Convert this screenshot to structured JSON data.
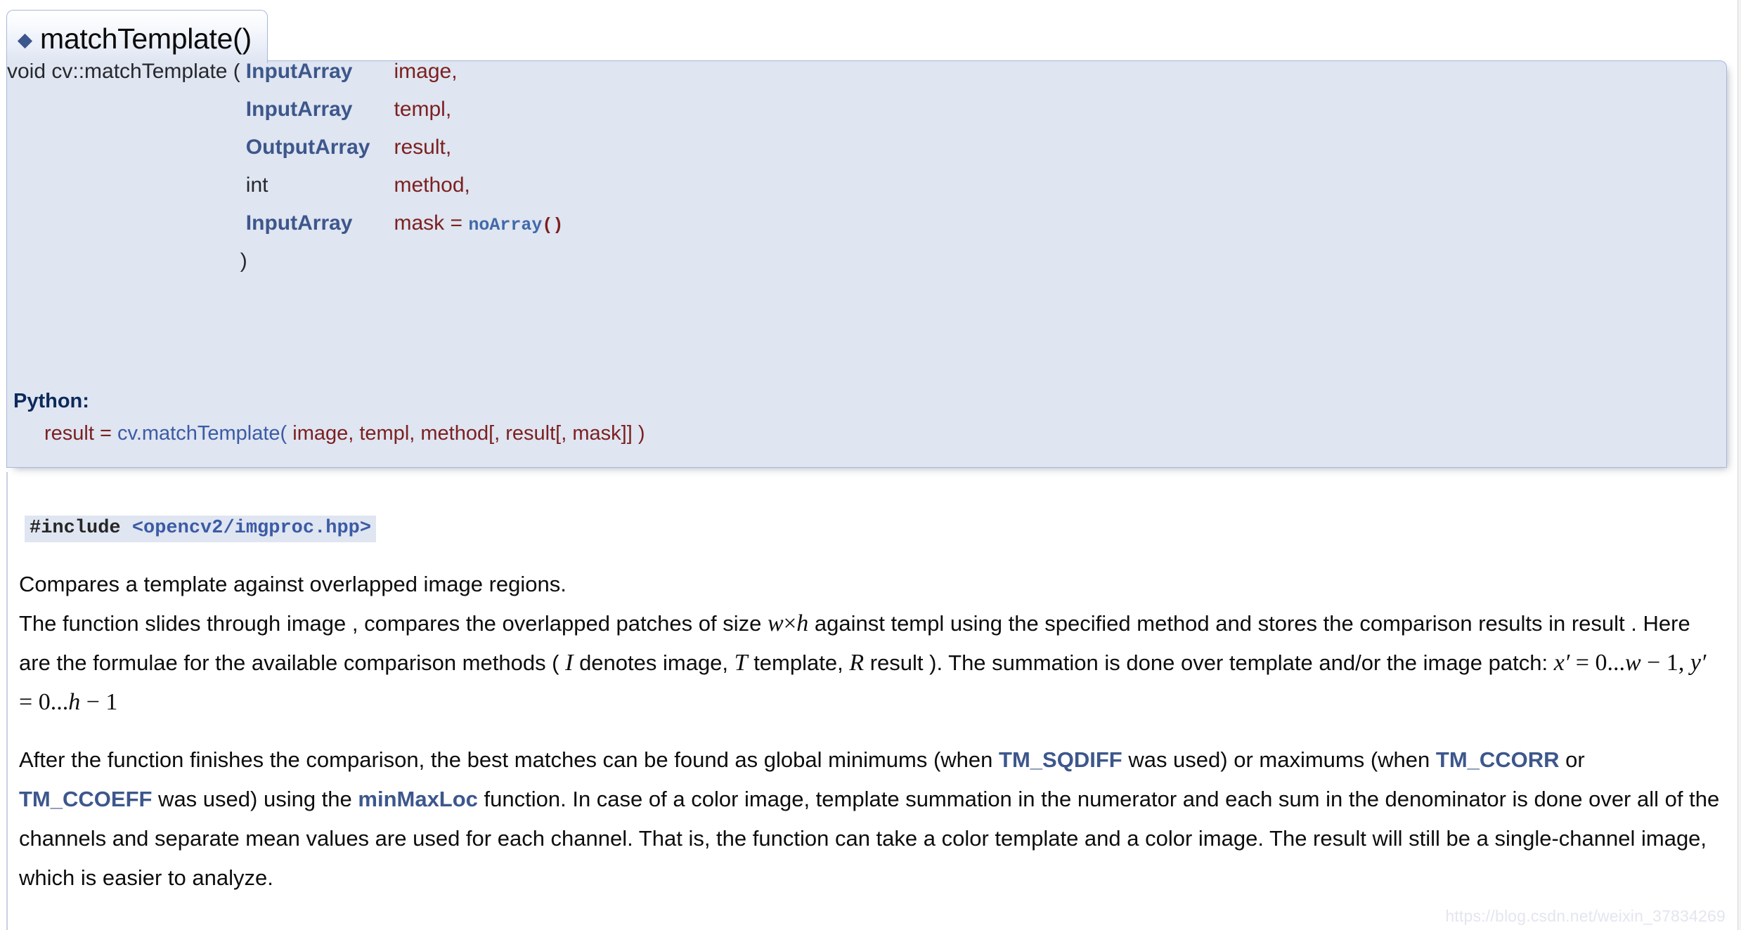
{
  "header": {
    "bullet_icon": "diamond-bullet-icon",
    "title": "matchTemplate()"
  },
  "prototype": {
    "return_and_name": "void cv::matchTemplate (",
    "close_paren": ")",
    "params": [
      {
        "type": "InputArray",
        "type_style": "link",
        "name": "image,"
      },
      {
        "type": "InputArray",
        "type_style": "link",
        "name": "templ,"
      },
      {
        "type": "OutputArray",
        "type_style": "link",
        "name": "result,"
      },
      {
        "type": "int",
        "type_style": "plain",
        "name": "method,"
      },
      {
        "type": "InputArray",
        "type_style": "link",
        "name": "mask = ",
        "default_fn": "noArray",
        "default_parens": "()"
      }
    ]
  },
  "python": {
    "label": "Python:",
    "assign": "result = ",
    "call": "cv.matchTemplate(",
    "args": " image, templ, method[, result[, mask]] )"
  },
  "doc": {
    "include": {
      "directive": "#include ",
      "header": "<opencv2/imgproc.hpp>"
    },
    "brief": "Compares a template against overlapped image regions.",
    "paragraph2": {
      "seg1": "The function slides through image , compares the overlapped patches of size ",
      "math_w": "w",
      "math_times": "×",
      "math_h": "h",
      "seg2": " against templ using the specified method and stores the comparison results in result . Here are the formulae for the available comparison methods ( ",
      "math_I": "I",
      "seg3": " denotes image, ",
      "math_T": "T",
      "seg4": " template, ",
      "math_R": "R",
      "seg5": " result ). The summation is done over template and/or the image patch: ",
      "formula_x": "x",
      "formula_prime1": "′",
      "formula_eq1": " = ",
      "formula_range1": "0...",
      "formula_w": "w",
      "formula_minus1": " − ",
      "formula_one1": "1",
      "formula_comma": ", ",
      "formula_y": "y",
      "formula_prime2": "′",
      "formula_eq2": " = ",
      "formula_range2": "0...",
      "formula_h": "h",
      "formula_minus2": " − ",
      "formula_one2": "1"
    },
    "paragraph3": {
      "seg1": "After the function finishes the comparison, the best matches can be found as global minimums (when ",
      "link_sqdiff": "TM_SQDIFF",
      "seg2": " was used) or maximums (when ",
      "link_ccorr": "TM_CCORR",
      "seg3": " or ",
      "link_ccoeff": "TM_CCOEFF",
      "seg4": " was used) using the ",
      "link_minmaxloc": "minMaxLoc",
      "seg5": " function. In case of a color image, template summation in the numerator and each sum in the denominator is done over all of the channels and separate mean values are used for each channel. That is, the function can take a color template and a color image. The result will still be a single-channel image, which is easier to analyze."
    }
  },
  "watermark": "https://blog.csdn.net/weixin_37834269",
  "colors": {
    "proto_bg": "#dfe5f1",
    "proto_border": "#a8b8d9",
    "link_blue": "#3d578c",
    "param_name_red": "#7c2020",
    "python_label": "#0b2a5b",
    "page_bg": "#ffffff"
  }
}
